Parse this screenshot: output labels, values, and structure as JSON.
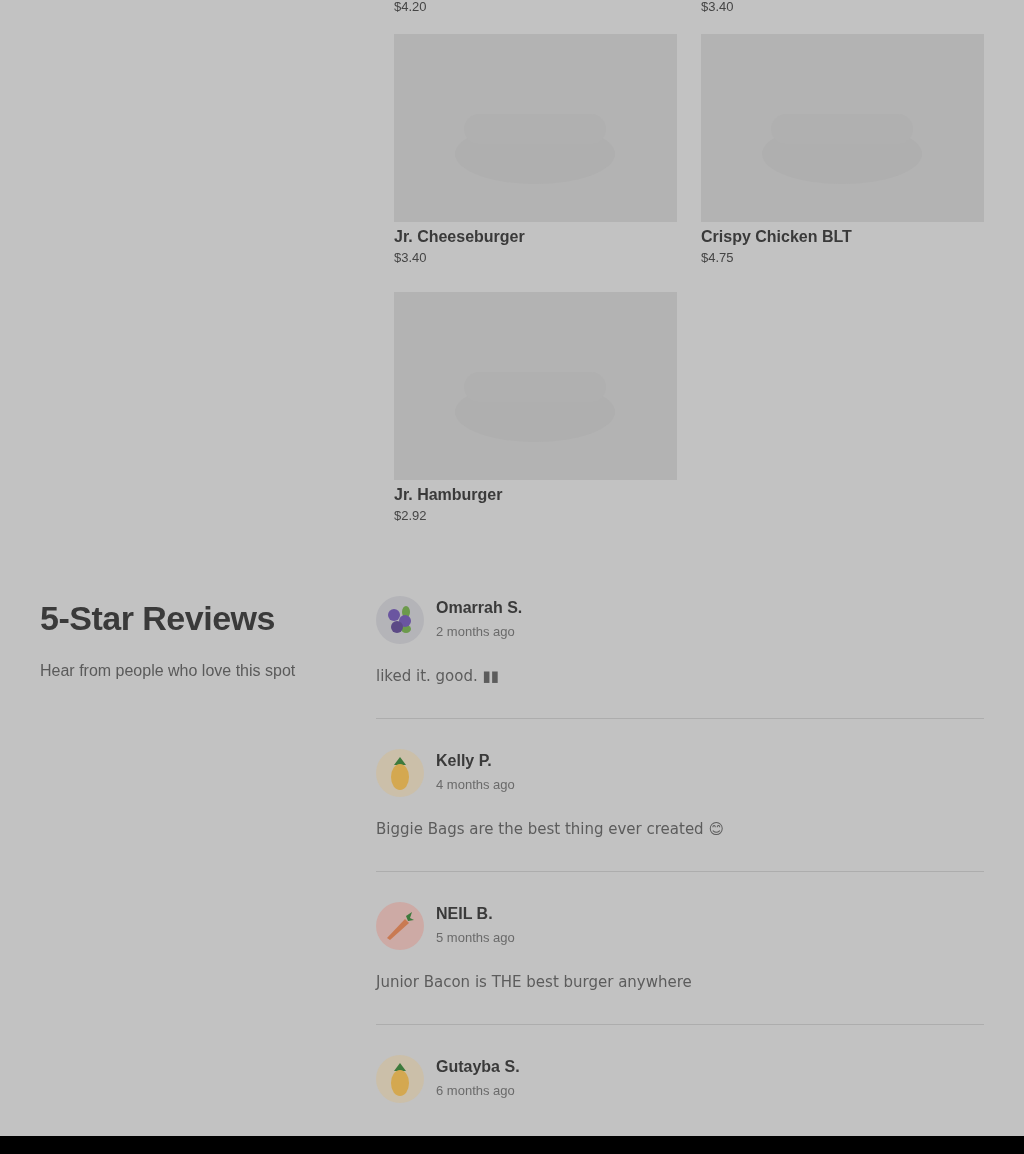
{
  "menu_items_top": [
    {
      "price": "$4.20"
    },
    {
      "price": "$3.40"
    }
  ],
  "menu_items": [
    {
      "name": "Jr. Cheeseburger",
      "price": "$3.40",
      "kind": "picture"
    },
    {
      "name": "Crispy Chicken BLT",
      "price": "$4.75",
      "kind": "picture"
    },
    {
      "name": "Jr. Hamburger",
      "price": "$2.92",
      "kind": "picture"
    }
  ],
  "reviews_section": {
    "title": "5-Star Reviews",
    "subtitle": "Hear from people who love this spot",
    "reviews": [
      {
        "kind": "berries",
        "name": "Omarrah S.",
        "time": "2 months ago",
        "text": "liked it. good. ▮▮"
      },
      {
        "kind": "pineapple",
        "name": "Kelly P.",
        "time": "4 months ago",
        "text": "Biggie Bags are the best thing ever created 😊"
      },
      {
        "kind": "carrot",
        "name": "NEIL B.",
        "time": "5 months ago",
        "text": "Junior Bacon is THE best burger anywhere"
      },
      {
        "kind": "pineapple",
        "name": "Gutayba S.",
        "time": "6 months ago"
      }
    ]
  }
}
